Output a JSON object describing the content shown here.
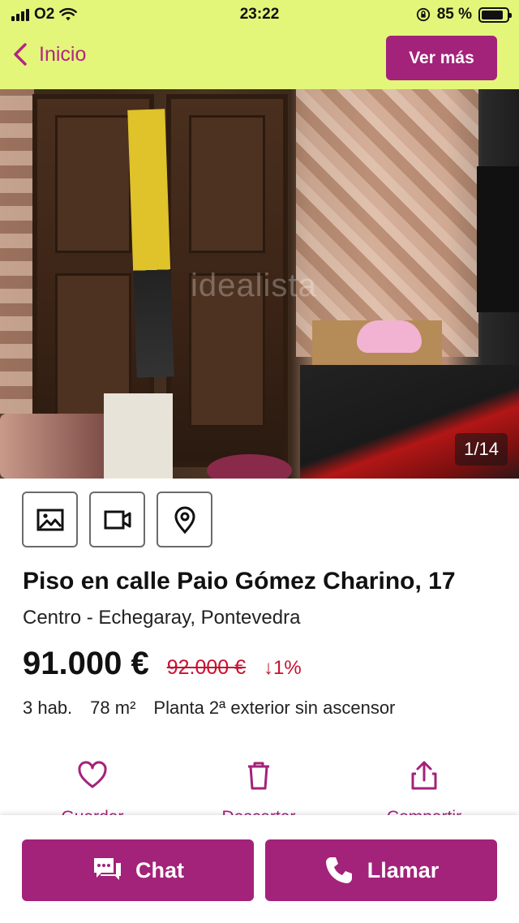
{
  "status": {
    "carrier": "O2",
    "time": "23:22",
    "battery": "85 %"
  },
  "header": {
    "back_label": "Inicio",
    "more_label": "Ver más"
  },
  "gallery": {
    "counter": "1/14",
    "watermark": "idealista"
  },
  "media_buttons": [
    "photo-icon",
    "video-icon",
    "map-pin-icon"
  ],
  "listing": {
    "title": "Piso en calle Paio Gómez Charino, 17",
    "location": "Centro - Echegaray, Pontevedra",
    "price": "91.000 €",
    "old_price": "92.000 €",
    "drop": "↓1%",
    "features": [
      "3 hab.",
      "78 m²",
      "Planta 2ª exterior sin ascensor"
    ]
  },
  "actions": [
    {
      "icon": "heart-icon",
      "label": "Guardar"
    },
    {
      "icon": "trash-icon",
      "label": "Descartar"
    },
    {
      "icon": "share-icon",
      "label": "Compartir"
    }
  ],
  "bottom": {
    "chat_label": "Chat",
    "call_label": "Llamar"
  },
  "colors": {
    "brand": "#a3227a",
    "header_bg": "#e3f67a",
    "price_drop": "#c8102e"
  }
}
